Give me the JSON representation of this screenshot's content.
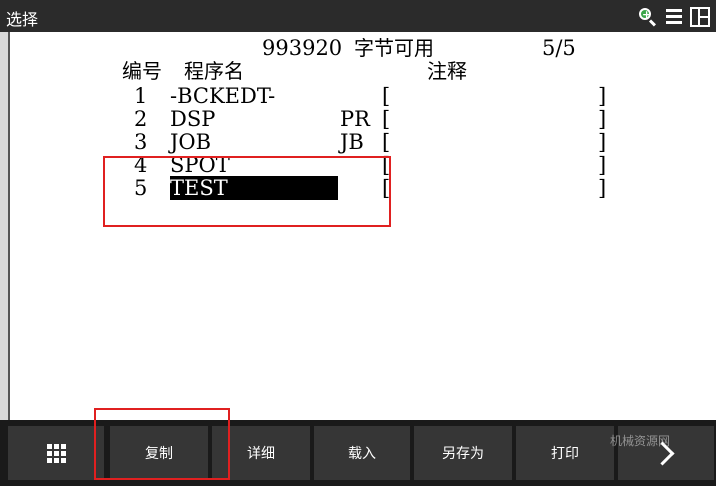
{
  "window": {
    "title": "选择"
  },
  "titlebar_icons": [
    "zoom-in-icon",
    "menu-icon",
    "layout-icon"
  ],
  "header": {
    "free_bytes": "993920",
    "free_label": "字节可用",
    "page": "5/5",
    "col_no": "编号",
    "col_name": "程序名",
    "col_comment": "注释"
  },
  "programs": [
    {
      "no": "1",
      "name": "-BCKEDT-",
      "type": "",
      "bracket_open": "[",
      "bracket_close": "]"
    },
    {
      "no": "2",
      "name": "DSP",
      "type": "PR",
      "bracket_open": "[",
      "bracket_close": "]"
    },
    {
      "no": "3",
      "name": "JOB",
      "type": "JB",
      "bracket_open": "[",
      "bracket_close": "]"
    },
    {
      "no": "4",
      "name": "SPOT",
      "type": "",
      "bracket_open": "[",
      "bracket_close": "]"
    },
    {
      "no": "5",
      "name": "TEST",
      "type": "",
      "bracket_open": "[",
      "bracket_close": "]",
      "selected": true
    }
  ],
  "toolbar": {
    "copy": "复制",
    "detail": "详细",
    "load": "载入",
    "save_as": "另存为",
    "print": "打印"
  },
  "watermark": "机械资源网"
}
